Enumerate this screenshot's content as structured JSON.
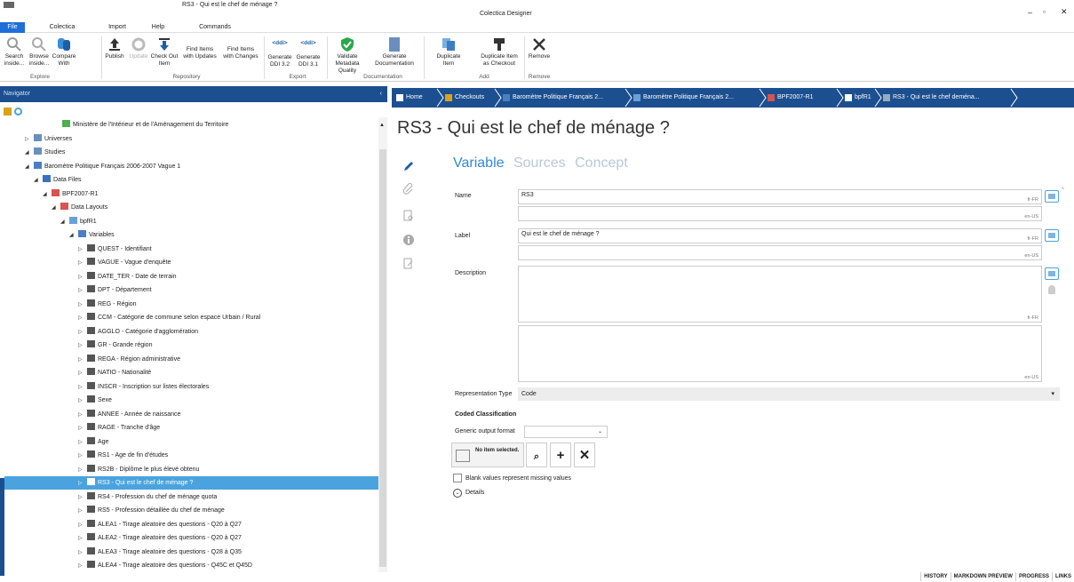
{
  "titlebar": {
    "document_title": "RS3 - Qui est le chef de ménage ?",
    "app_title": "Colectica Designer"
  },
  "menu": {
    "file": "File",
    "colectica": "Colectica",
    "import": "Import",
    "help": "Help",
    "commands": "Commands"
  },
  "ribbon": {
    "search": "Search inside...",
    "browse": "Browse inside...",
    "compare": "Compare With",
    "publish": "Publish",
    "update": "Update",
    "checkout": "Check Out Item",
    "find_items_updates": "Find Items with Updates",
    "find_items_changes": "Find Items with Changes",
    "gen_ddi32": "Generate DDI 3.2",
    "gen_ddi31": "Generate DDI 3.1",
    "validate": "Validate Metadata Quality",
    "gen_doc": "Generate Documentation",
    "dup_item": "Duplicate Item",
    "dup_checkout": "Duplicate Item as Checkout",
    "remove": "Remove",
    "ddi_tag": "<ddi>",
    "groups": {
      "explore": "Explore",
      "repository": "Repository",
      "export": "Export",
      "documentation": "Documentation",
      "add": "Add",
      "remove": "Remove"
    }
  },
  "navigator": {
    "title": "Navigator",
    "tree": [
      {
        "label": "Ministère de l'Intérieur et de l'Aménagement du Territoire",
        "indent": 0,
        "toggle": ""
      },
      {
        "label": "Universes",
        "indent": 1,
        "toggle": "▷"
      },
      {
        "label": "Studies",
        "indent": 1,
        "toggle": "◢"
      },
      {
        "label": "Baromètre Politique Français 2006-2007 Vague 1",
        "indent": 2,
        "toggle": "◢"
      },
      {
        "label": "Data Files",
        "indent": 3,
        "toggle": "◢"
      },
      {
        "label": "BPF2007-R1",
        "indent": 4,
        "toggle": "◢"
      },
      {
        "label": "Data Layouts",
        "indent": 5,
        "toggle": "◢"
      },
      {
        "label": "bpfR1",
        "indent": 6,
        "toggle": "◢"
      },
      {
        "label": "Variables",
        "indent": 7,
        "toggle": "◢"
      },
      {
        "label": "QUEST - Identifiant",
        "indent": 8,
        "toggle": "▷"
      },
      {
        "label": "VAGUE - Vague d'enquête",
        "indent": 8,
        "toggle": "▷"
      },
      {
        "label": "DATE_TER - Date de terrain",
        "indent": 8,
        "toggle": "▷"
      },
      {
        "label": "DPT - Département",
        "indent": 8,
        "toggle": "▷"
      },
      {
        "label": "REG - Région",
        "indent": 8,
        "toggle": "▷"
      },
      {
        "label": "CCM - Catégorie de commune selon espace Urbain / Rural",
        "indent": 8,
        "toggle": "▷"
      },
      {
        "label": "AGGLO - Catégorie d'agglomération",
        "indent": 8,
        "toggle": "▷"
      },
      {
        "label": "GR - Grande région",
        "indent": 8,
        "toggle": "▷"
      },
      {
        "label": "REGA - Région administrative",
        "indent": 8,
        "toggle": "▷"
      },
      {
        "label": "NATIO - Nationalité",
        "indent": 8,
        "toggle": "▷"
      },
      {
        "label": "INSCR - Inscription sur listes électorales",
        "indent": 8,
        "toggle": "▷"
      },
      {
        "label": "Sexe",
        "indent": 8,
        "toggle": "▷"
      },
      {
        "label": "ANNEE - Année de naissance",
        "indent": 8,
        "toggle": "▷"
      },
      {
        "label": "RAGE - Tranche d'âge",
        "indent": 8,
        "toggle": "▷"
      },
      {
        "label": "Age",
        "indent": 8,
        "toggle": "▷"
      },
      {
        "label": "RS1 - Age de fin d'études",
        "indent": 8,
        "toggle": "▷"
      },
      {
        "label": "RS2B - Diplôme le plus élevé obtenu",
        "indent": 8,
        "toggle": "▷"
      },
      {
        "label": "RS3 - Qui est le chef de ménage ?",
        "indent": 8,
        "toggle": "▷",
        "selected": true
      },
      {
        "label": "RS4 - Profession du chef de ménage quota",
        "indent": 8,
        "toggle": "▷"
      },
      {
        "label": "RS5 - Profession détaillée du chef de ménage",
        "indent": 8,
        "toggle": "▷"
      },
      {
        "label": "ALEA1 - Tirage aleatoire des questions - Q20 à Q27",
        "indent": 8,
        "toggle": "▷"
      },
      {
        "label": "ALEA2 - Tirage aleatoire des questions - Q20 à Q27",
        "indent": 8,
        "toggle": "▷"
      },
      {
        "label": "ALEA3 - Tirage aleatoire des questions - Q28 à Q35",
        "indent": 8,
        "toggle": "▷"
      },
      {
        "label": "ALEA4 - Tirage aleatoire des questions - Q45C et Q45D",
        "indent": 8,
        "toggle": "▷"
      }
    ]
  },
  "breadcrumb": [
    "Home",
    "Checkouts",
    "Baromètre Politique Français 2...",
    "Baromètre Politique Français 2...",
    "BPF2007-R1",
    "bpfR1",
    "RS3 - Qui est le chef deména..."
  ],
  "editor": {
    "title": "RS3 - Qui est le chef de ménage ?",
    "tabs": {
      "variable": "Variable",
      "sources": "Sources",
      "concept": "Concept"
    },
    "name_label": "Name",
    "name_value": "RS3",
    "label_label": "Label",
    "label_value": "Qui est le chef de ménage ?",
    "description_label": "Description",
    "lang_fr": "fr-FR",
    "lang_en": "en-US",
    "rep_type_label": "Representation Type",
    "rep_type_value": "Code",
    "coded_classification": "Coded Classification",
    "generic_output_label": "Generic output format",
    "no_item": "No item selected.",
    "blank_values": "Blank values represent missing values",
    "details": "Details"
  },
  "bottom_tabs": [
    "HISTORY",
    "MARKDOWN PREVIEW",
    "PROGRESS",
    "LINKS"
  ],
  "colors": {
    "accent": "#1c4f8f",
    "selection": "#4aa3df",
    "file_menu": "#1e6fd9"
  }
}
